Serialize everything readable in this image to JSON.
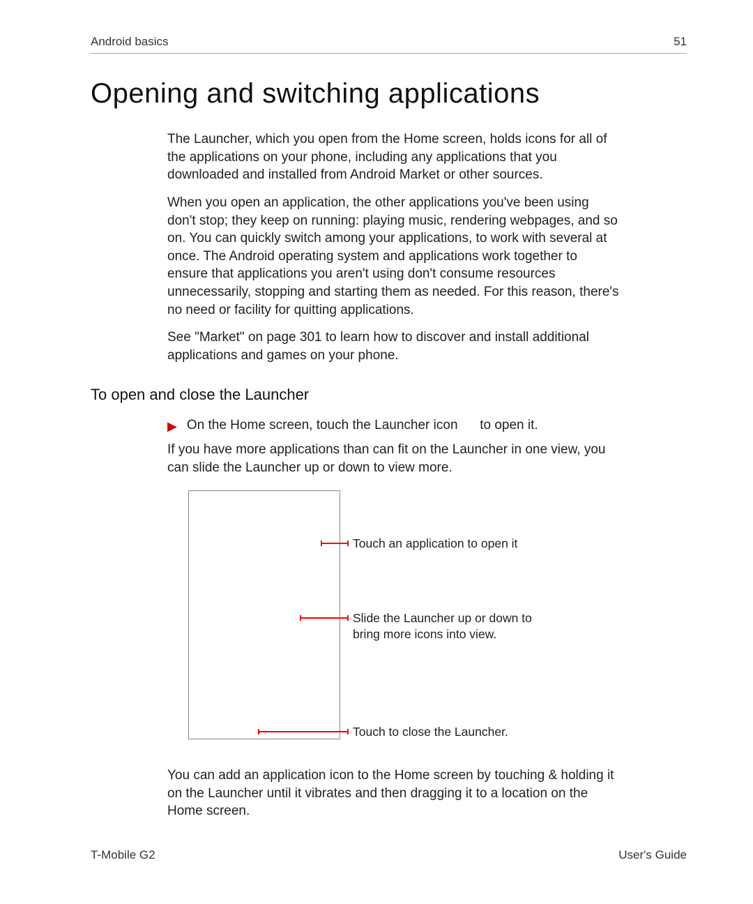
{
  "header": {
    "section": "Android basics",
    "page_number": "51"
  },
  "title": "Opening and switching applications",
  "paragraphs": {
    "intro1": "The Launcher, which you open from the Home screen, holds icons for all of the applications on your phone, including any applications that you downloaded and installed from Android Market or other sources.",
    "intro2": "When you open an application, the other applications you've been using don't stop; they keep on running: playing music, rendering webpages, and so on. You can quickly switch among your applications, to work with several at once. The Android operating system and applications work together to ensure that applications you aren't using don't consume resources unnecessarily, stopping and starting them as needed. For this reason, there's no need or facility for quitting applications.",
    "intro3": "See \"Market\" on page 301 to learn how to discover and install additional applications and games on your phone."
  },
  "subhead": "To open and close the Launcher",
  "bullet": {
    "main": "On the Home screen, touch the Launcher icon      to open it.",
    "follow": "If you have more applications than can fit on the Launcher in one view, you can slide the Launcher up or down to view more."
  },
  "callouts": {
    "c1": "Touch an application to open it",
    "c2": "Slide the Launcher up or down to bring more icons into view.",
    "c3": "Touch to close the Launcher."
  },
  "after_diagram": "You can add an application icon to the Home screen by touching & holding it on the Launcher until it vibrates and then dragging it to a location on the Home screen.",
  "footer": {
    "left": "T-Mobile G2",
    "right": "User's Guide"
  }
}
